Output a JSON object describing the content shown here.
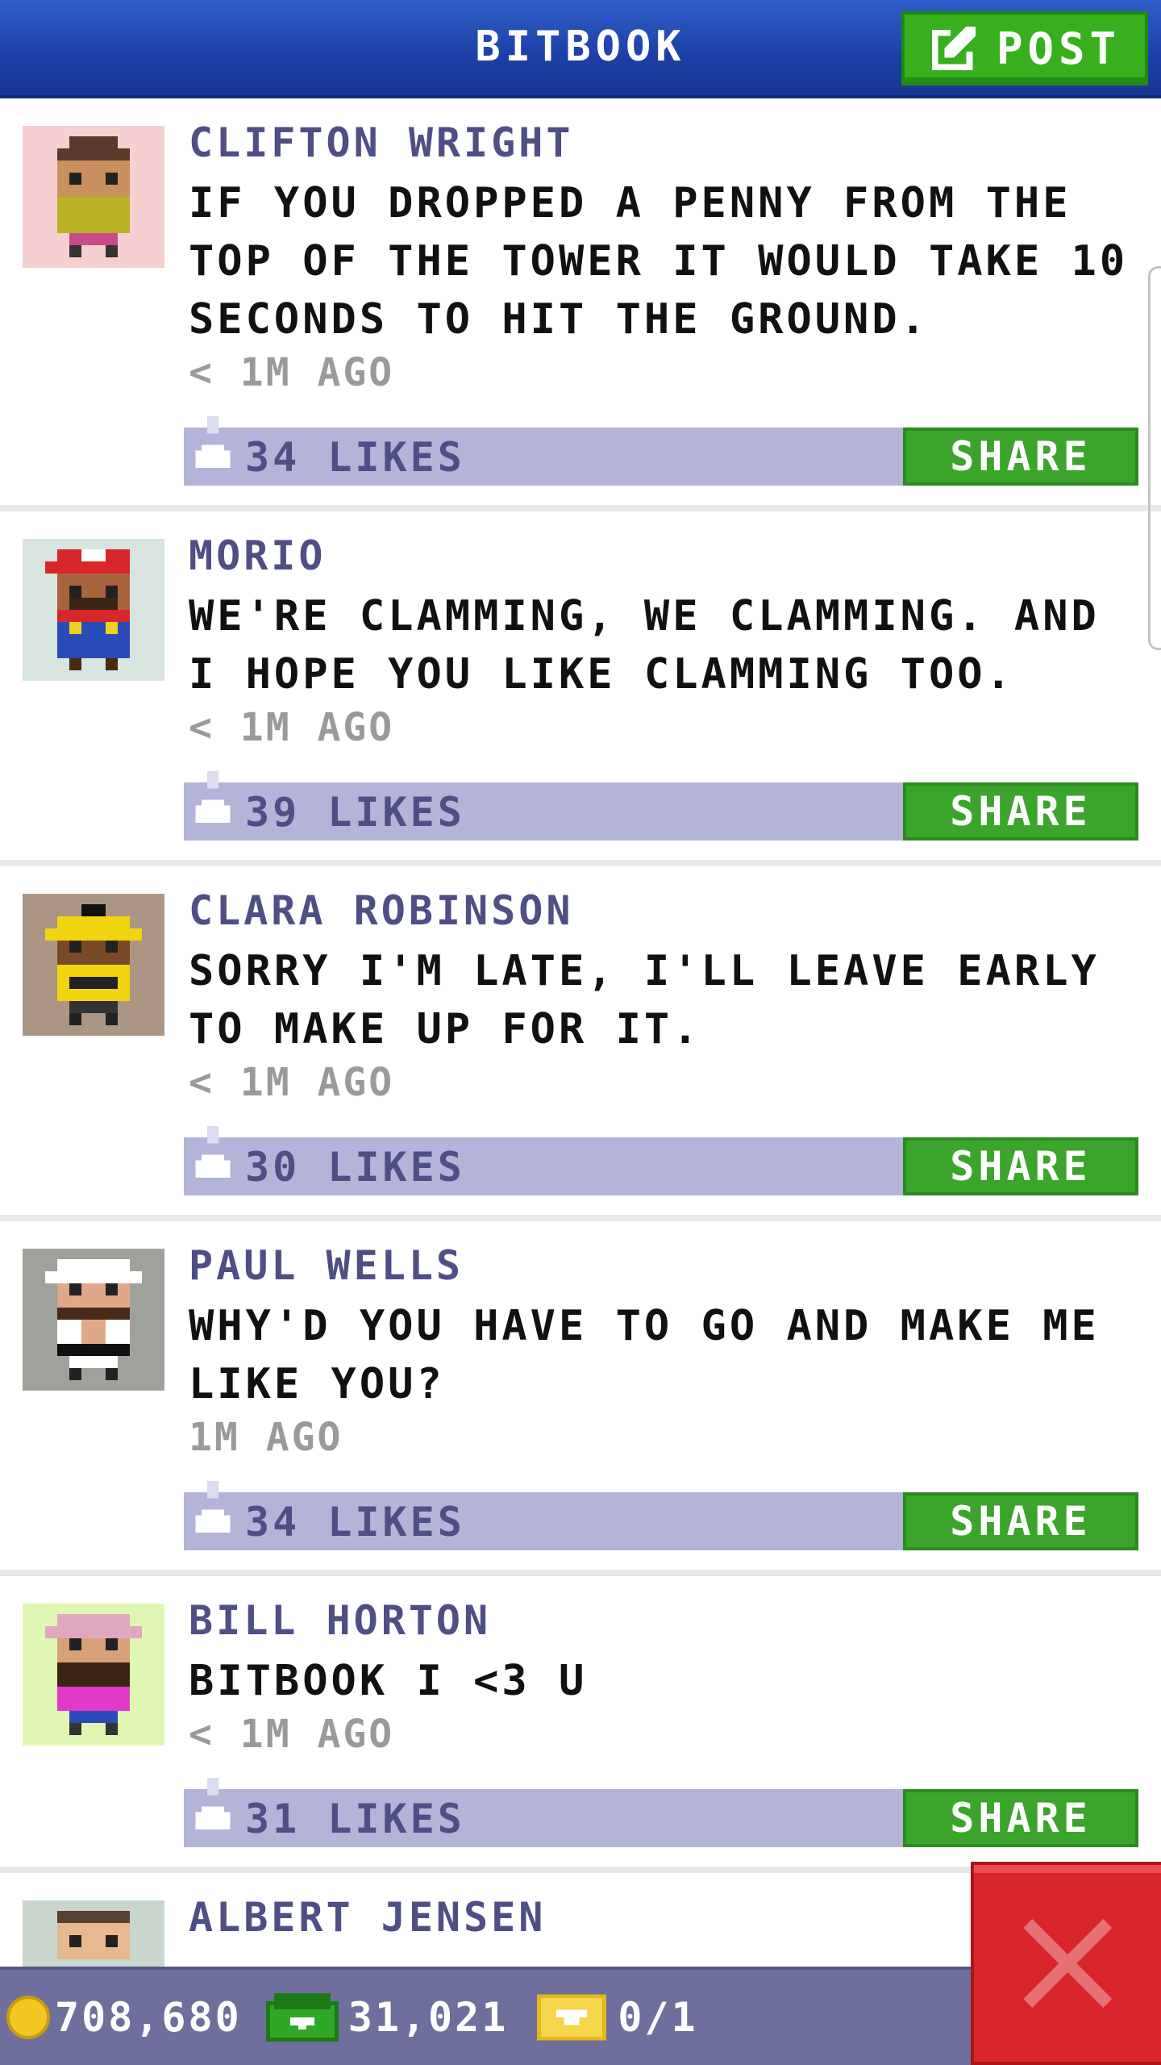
{
  "header": {
    "title": "BITBOOK",
    "post_label": "POST"
  },
  "posts": [
    {
      "author": "CLIFTON WRIGHT",
      "message": "IF YOU DROPPED A PENNY FROM THE TOP OF THE TOWER IT WOULD TAKE 10 SECONDS TO HIT THE GROUND.",
      "time": "< 1M AGO",
      "likes": "34 LIKES",
      "share_label": "SHARE",
      "avatar_bg": "#f6d0d0"
    },
    {
      "author": "MORIO",
      "message": "WE'RE CLAMMING, WE CLAMMING. AND I HOPE YOU LIKE CLAMMING TOO.",
      "time": "< 1M AGO",
      "likes": "39 LIKES",
      "share_label": "SHARE",
      "avatar_bg": "#d8e4e0"
    },
    {
      "author": "CLARA ROBINSON",
      "message": "SORRY I'M LATE, I'LL LEAVE EARLY TO MAKE UP FOR IT.",
      "time": "< 1M AGO",
      "likes": "30 LIKES",
      "share_label": "SHARE",
      "avatar_bg": "#ab9683"
    },
    {
      "author": "PAUL WELLS",
      "message": "WHY'D YOU HAVE TO GO AND MAKE ME LIKE YOU?",
      "time": "1M AGO",
      "likes": "34 LIKES",
      "share_label": "SHARE",
      "avatar_bg": "#9ea29a"
    },
    {
      "author": "BILL HORTON",
      "message": "BITBOOK I <3 U",
      "time": "< 1M AGO",
      "likes": "31 LIKES",
      "share_label": "SHARE",
      "avatar_bg": "#dff7b3"
    },
    {
      "author": "ALBERT JENSEN",
      "avatar_bg": "#c9d6cc"
    }
  ],
  "status_bar": {
    "coins": "708,680",
    "bux": "31,021",
    "vip": "0/1"
  },
  "colors": {
    "header_blue": "#1c3fa6",
    "likes_bar": "#b3b4d8",
    "share_green": "#3aa52a",
    "close_red": "#d9262c"
  }
}
